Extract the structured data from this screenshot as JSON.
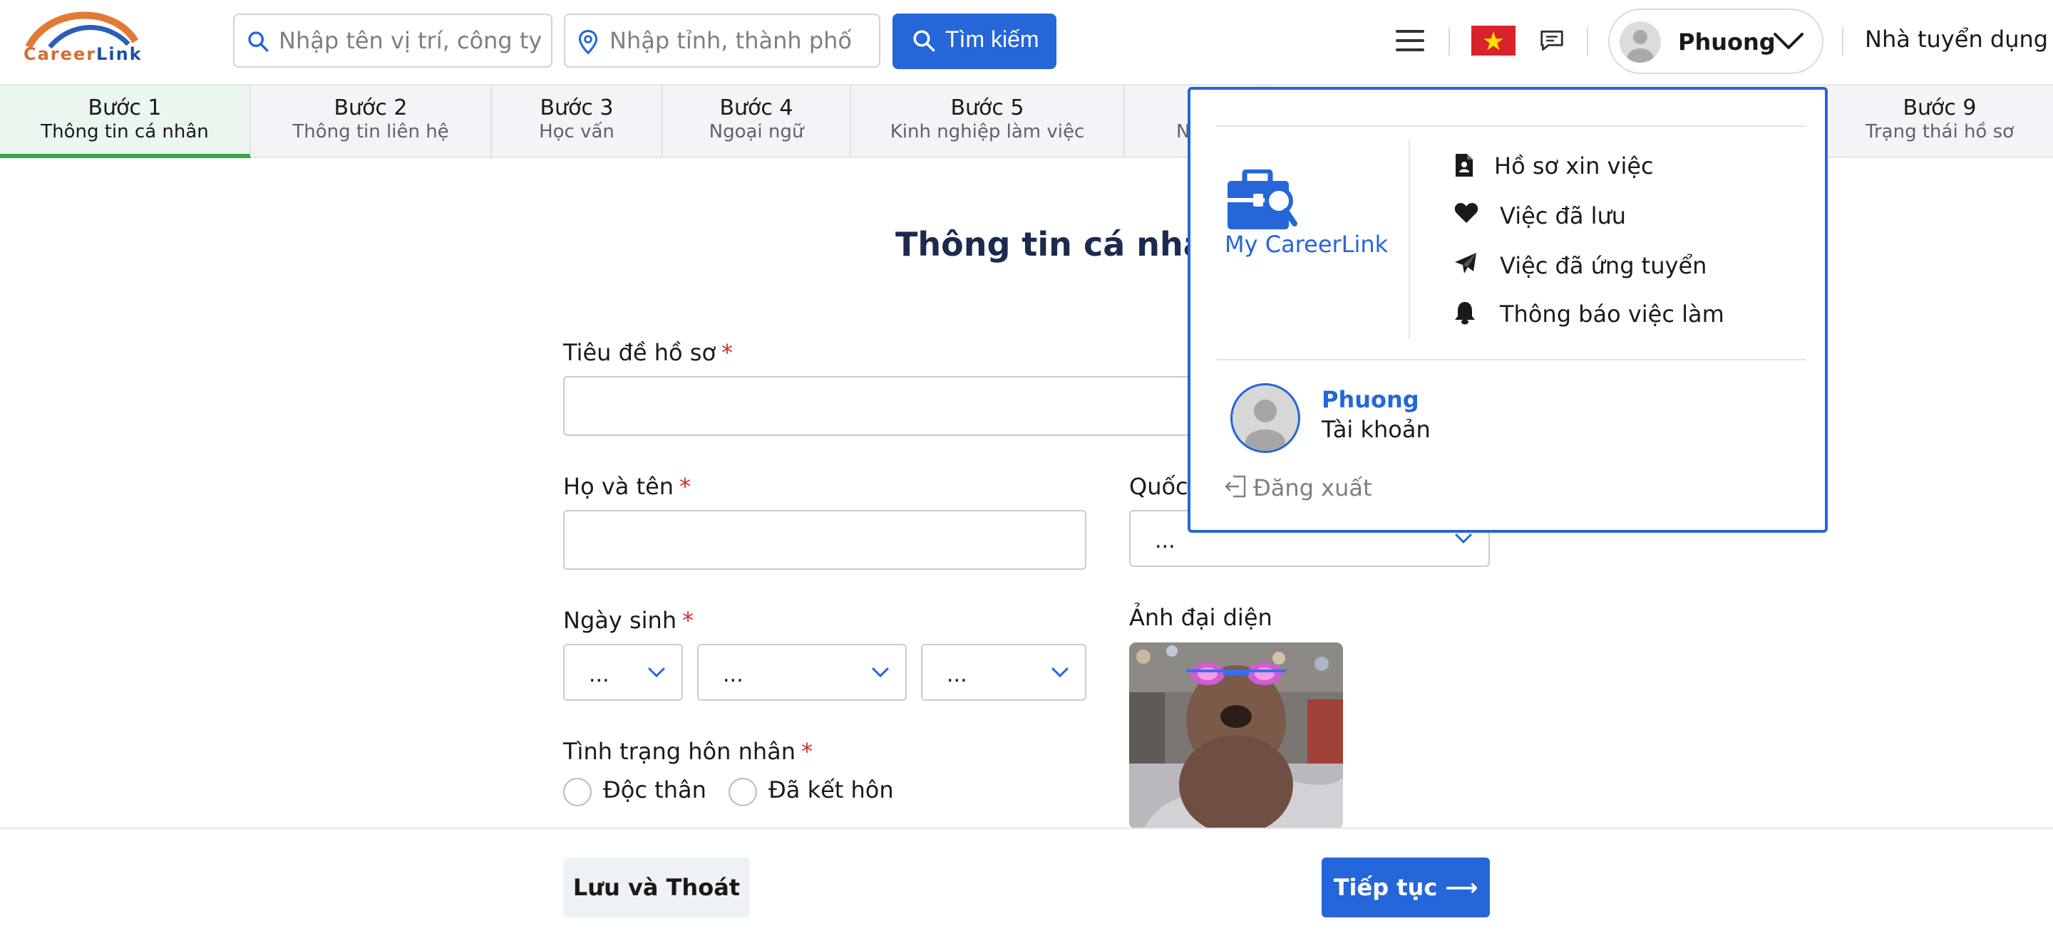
{
  "header": {
    "logo_text_a": "Career",
    "logo_text_b": "Link",
    "keyword_placeholder": "Nhập tên vị trí, công ty, từ khóa",
    "location_placeholder": "Nhập tỉnh, thành phố",
    "search_label": "Tìm kiếm",
    "user_name": "Phuong",
    "employer_label": "Nhà tuyển dụng",
    "flag": "vietnam-flag-icon"
  },
  "steps": [
    {
      "num": "Bước 1",
      "label": "Thông tin cá nhân",
      "active": true
    },
    {
      "num": "Bước 2",
      "label": "Thông tin liên hệ"
    },
    {
      "num": "Bước 3",
      "label": "Học vấn"
    },
    {
      "num": "Bước 4",
      "label": "Ngoại ngữ"
    },
    {
      "num": "Bước 5",
      "label": "Kinh nghiệp làm việc"
    },
    {
      "num": "",
      "label": "N"
    },
    {
      "num": "Bước 9",
      "label": "Trạng thái hồ sơ"
    }
  ],
  "form": {
    "title": "Thông tin cá nhân",
    "resume_title_label": "Tiêu đề hồ sơ",
    "full_name_label": "Họ và tên",
    "nationality_label": "Quốc",
    "nationality_value": "...",
    "dob_label": "Ngày sinh",
    "dob_day": "...",
    "dob_month": "...",
    "dob_year": "...",
    "avatar_label": "Ảnh đại diện",
    "marital_label": "Tình trạng hôn nhân",
    "marital_options": [
      "Độc thân",
      "Đã kết hôn"
    ],
    "required_mark": "*"
  },
  "footer": {
    "save_exit_label": "Lưu và Thoát",
    "continue_label": "Tiếp tục ⟶"
  },
  "user_menu": {
    "brand_label": "My CareerLink",
    "items": [
      {
        "label": "Hồ sơ xin việc",
        "icon": "file-user-icon"
      },
      {
        "label": "Việc đã lưu",
        "icon": "heart-icon"
      },
      {
        "label": "Việc đã ứng tuyển",
        "icon": "paper-plane-icon"
      },
      {
        "label": "Thông báo việc làm",
        "icon": "bell-icon"
      }
    ],
    "account_name": "Phuong",
    "account_label": "Tài khoản",
    "logout_label": "Đăng xuất"
  },
  "colors": {
    "primary": "#2566d8",
    "active_step": "#3aa64a",
    "required": "#d42b2b",
    "title": "#1b2a4e"
  }
}
